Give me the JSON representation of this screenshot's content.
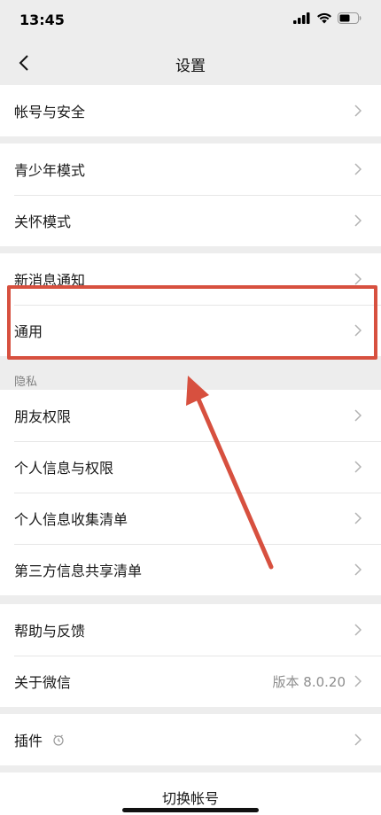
{
  "status_bar": {
    "time": "13:45"
  },
  "nav": {
    "title": "设置",
    "back_icon": "chevron-left-icon"
  },
  "groups": {
    "account": {
      "items": [
        {
          "label": "帐号与安全"
        }
      ]
    },
    "modes": {
      "items": [
        {
          "label": "青少年模式"
        },
        {
          "label": "关怀模式"
        }
      ]
    },
    "general": {
      "items": [
        {
          "label": "新消息通知"
        },
        {
          "label": "通用"
        }
      ]
    },
    "privacy": {
      "section_title": "隐私",
      "items": [
        {
          "label": "朋友权限"
        },
        {
          "label": "个人信息与权限"
        },
        {
          "label": "个人信息收集清单"
        },
        {
          "label": "第三方信息共享清单"
        }
      ]
    },
    "help": {
      "items": [
        {
          "label": "帮助与反馈"
        },
        {
          "label": "关于微信",
          "value": "版本 8.0.20"
        }
      ]
    },
    "plugins": {
      "items": [
        {
          "label": "插件",
          "icon": "plugin-icon"
        }
      ]
    }
  },
  "bottom": {
    "switch_account_label": "切换帐号"
  },
  "annotation": {
    "highlight_color": "#d7503f"
  }
}
